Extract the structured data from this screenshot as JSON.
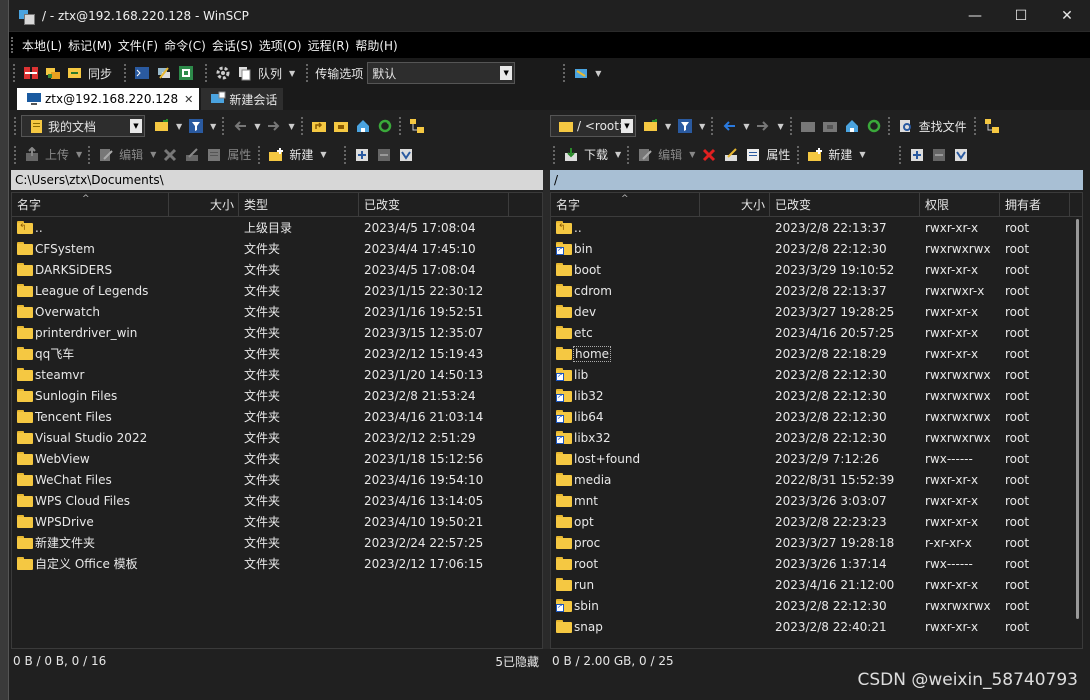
{
  "window": {
    "title": "/ - ztx@192.168.220.128 - WinSCP",
    "minimize": "—",
    "maximize": "☐",
    "close": "✕"
  },
  "menu": [
    "本地(L)",
    "标记(M)",
    "文件(F)",
    "命令(C)",
    "会话(S)",
    "选项(O)",
    "远程(R)",
    "帮助(H)"
  ],
  "toolbar": {
    "sync_label": "同步",
    "queue_label": "队列",
    "transfer_options_label": "传输选项",
    "transfer_preset": "默认"
  },
  "tabs": {
    "session": "ztx@192.168.220.128",
    "new_session": "新建会话"
  },
  "left_pane": {
    "location": "我的文档",
    "upload_label": "上传",
    "edit_label": "编辑",
    "properties_label": "属性",
    "new_label": "新建",
    "path": "C:\\Users\\ztx\\Documents\\",
    "columns": {
      "name": "名字",
      "size": "大小",
      "type": "类型",
      "changed": "已改变"
    },
    "files": [
      {
        "name": "..",
        "type": "上级目录",
        "changed": "2023/4/5  17:08:04",
        "up": true
      },
      {
        "name": "CFSystem",
        "type": "文件夹",
        "changed": "2023/4/4  17:45:10"
      },
      {
        "name": "DARKSiDERS",
        "type": "文件夹",
        "changed": "2023/4/5  17:08:04"
      },
      {
        "name": "League of Legends",
        "type": "文件夹",
        "changed": "2023/1/15  22:30:12"
      },
      {
        "name": "Overwatch",
        "type": "文件夹",
        "changed": "2023/1/16  19:52:51"
      },
      {
        "name": "printerdriver_win",
        "type": "文件夹",
        "changed": "2023/3/15  12:35:07"
      },
      {
        "name": "qq飞车",
        "type": "文件夹",
        "changed": "2023/2/12  15:19:43"
      },
      {
        "name": "steamvr",
        "type": "文件夹",
        "changed": "2023/1/20  14:50:13"
      },
      {
        "name": "Sunlogin Files",
        "type": "文件夹",
        "changed": "2023/2/8  21:53:24"
      },
      {
        "name": "Tencent Files",
        "type": "文件夹",
        "changed": "2023/4/16  21:03:14"
      },
      {
        "name": "Visual Studio 2022",
        "type": "文件夹",
        "changed": "2023/2/12  2:51:29"
      },
      {
        "name": "WebView",
        "type": "文件夹",
        "changed": "2023/1/18  15:12:56"
      },
      {
        "name": "WeChat Files",
        "type": "文件夹",
        "changed": "2023/4/16  19:54:10"
      },
      {
        "name": "WPS Cloud Files",
        "type": "文件夹",
        "changed": "2023/4/16  13:14:05"
      },
      {
        "name": "WPSDrive",
        "type": "文件夹",
        "changed": "2023/4/10  19:50:21"
      },
      {
        "name": "新建文件夹",
        "type": "文件夹",
        "changed": "2023/2/24  22:57:25"
      },
      {
        "name": "自定义 Office 模板",
        "type": "文件夹",
        "changed": "2023/2/12  17:06:15"
      }
    ],
    "status_selected": "0 B / 0 B,  0 / 16",
    "status_hidden": "5已隐藏"
  },
  "right_pane": {
    "location": "/ <root>",
    "download_label": "下载",
    "edit_label": "编辑",
    "properties_label": "属性",
    "new_label": "新建",
    "find_label": "查找文件",
    "path": "/",
    "columns": {
      "name": "名字",
      "size": "大小",
      "changed": "已改变",
      "rights": "权限",
      "owner": "拥有者"
    },
    "files": [
      {
        "name": "..",
        "changed": "2023/2/8 22:13:37",
        "rights": "rwxr-xr-x",
        "owner": "root",
        "up": true
      },
      {
        "name": "bin",
        "changed": "2023/2/8 22:12:30",
        "rights": "rwxrwxrwx",
        "owner": "root",
        "link": true
      },
      {
        "name": "boot",
        "changed": "2023/3/29 19:10:52",
        "rights": "rwxr-xr-x",
        "owner": "root"
      },
      {
        "name": "cdrom",
        "changed": "2023/2/8 22:13:37",
        "rights": "rwxrwxr-x",
        "owner": "root"
      },
      {
        "name": "dev",
        "changed": "2023/3/27 19:28:25",
        "rights": "rwxr-xr-x",
        "owner": "root"
      },
      {
        "name": "etc",
        "changed": "2023/4/16 20:57:25",
        "rights": "rwxr-xr-x",
        "owner": "root"
      },
      {
        "name": "home",
        "changed": "2023/2/8 22:18:29",
        "rights": "rwxr-xr-x",
        "owner": "root",
        "focused": true
      },
      {
        "name": "lib",
        "changed": "2023/2/8 22:12:30",
        "rights": "rwxrwxrwx",
        "owner": "root",
        "link": true
      },
      {
        "name": "lib32",
        "changed": "2023/2/8 22:12:30",
        "rights": "rwxrwxrwx",
        "owner": "root",
        "link": true
      },
      {
        "name": "lib64",
        "changed": "2023/2/8 22:12:30",
        "rights": "rwxrwxrwx",
        "owner": "root",
        "link": true
      },
      {
        "name": "libx32",
        "changed": "2023/2/8 22:12:30",
        "rights": "rwxrwxrwx",
        "owner": "root",
        "link": true
      },
      {
        "name": "lost+found",
        "changed": "2023/2/9 7:12:26",
        "rights": "rwx------",
        "owner": "root"
      },
      {
        "name": "media",
        "changed": "2022/8/31 15:52:39",
        "rights": "rwxr-xr-x",
        "owner": "root"
      },
      {
        "name": "mnt",
        "changed": "2023/3/26 3:03:07",
        "rights": "rwxr-xr-x",
        "owner": "root"
      },
      {
        "name": "opt",
        "changed": "2023/2/8 22:23:23",
        "rights": "rwxr-xr-x",
        "owner": "root"
      },
      {
        "name": "proc",
        "changed": "2023/3/27 19:28:18",
        "rights": "r-xr-xr-x",
        "owner": "root"
      },
      {
        "name": "root",
        "changed": "2023/3/26 1:37:14",
        "rights": "rwx------",
        "owner": "root"
      },
      {
        "name": "run",
        "changed": "2023/4/16 21:12:00",
        "rights": "rwxr-xr-x",
        "owner": "root"
      },
      {
        "name": "sbin",
        "changed": "2023/2/8 22:12:30",
        "rights": "rwxrwxrwx",
        "owner": "root",
        "link": true
      },
      {
        "name": "snap",
        "changed": "2023/2/8 22:40:21",
        "rights": "rwxr-xr-x",
        "owner": "root"
      }
    ],
    "status_selected": "0 B / 2.00 GB,  0 / 25"
  },
  "watermark": "CSDN @weixin_58740793",
  "colors": {
    "window_bg": "#202020",
    "folder": "#f5c842",
    "left_path_bg": "#d7d7d7",
    "right_path_bg": "#a8bfd4"
  }
}
